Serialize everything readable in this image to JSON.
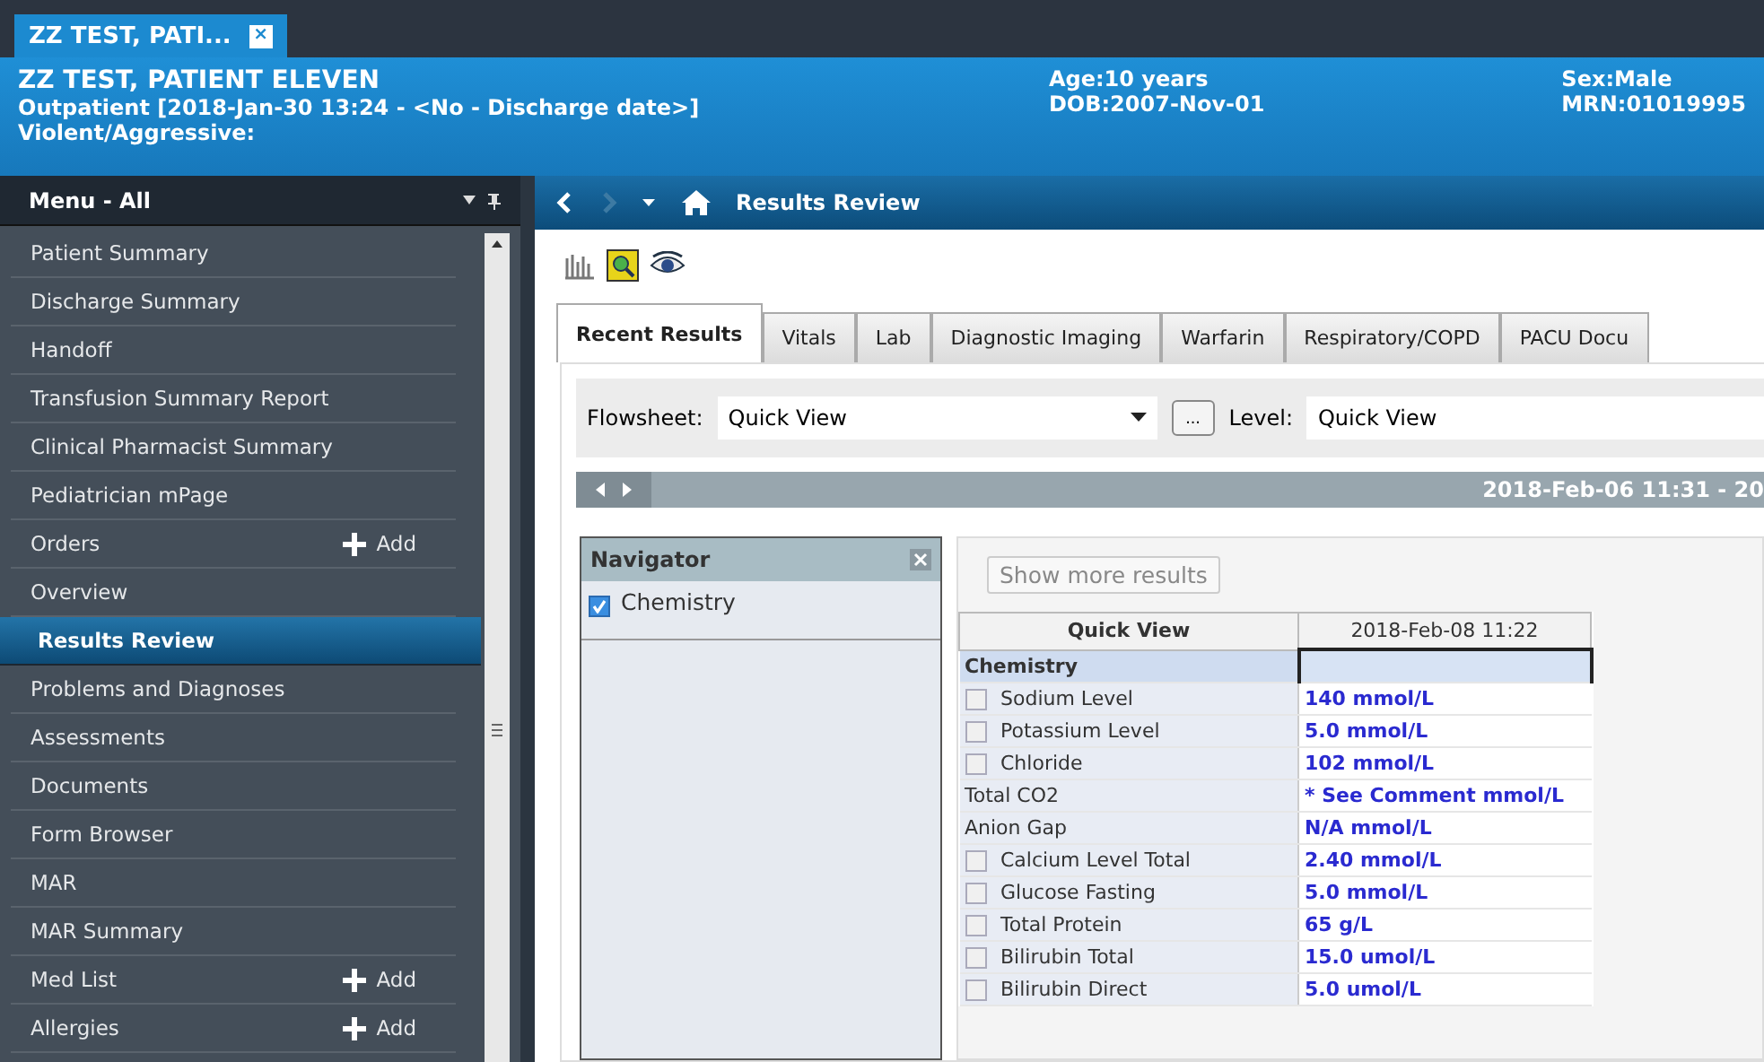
{
  "patient_tab": {
    "label": "ZZ TEST, PATI...",
    "close": "×"
  },
  "banner": {
    "name": "ZZ TEST, PATIENT ELEVEN",
    "encounter": "Outpatient [2018-Jan-30 13:24 -  <No - Discharge date>]",
    "alert": "Violent/Aggressive:",
    "age": "Age:10 years",
    "dob": "DOB:2007-Nov-01",
    "sex": "Sex:Male",
    "mrn": "MRN:01019995"
  },
  "menu": {
    "title": "Menu - All",
    "items": [
      {
        "label": "Patient Summary",
        "selected": false
      },
      {
        "label": "Discharge Summary",
        "selected": false
      },
      {
        "label": "Handoff",
        "selected": false
      },
      {
        "label": "Transfusion Summary Report",
        "selected": false
      },
      {
        "label": "Clinical Pharmacist Summary",
        "selected": false
      },
      {
        "label": "Pediatrician mPage",
        "selected": false
      },
      {
        "label": "Orders",
        "selected": false,
        "add": "Add"
      },
      {
        "label": "Overview",
        "selected": false
      },
      {
        "label": "Results Review",
        "selected": true
      },
      {
        "label": "Problems and Diagnoses",
        "selected": false
      },
      {
        "label": "Assessments",
        "selected": false
      },
      {
        "label": "Documents",
        "selected": false
      },
      {
        "label": "Form Browser",
        "selected": false
      },
      {
        "label": "MAR",
        "selected": false
      },
      {
        "label": "MAR Summary",
        "selected": false
      },
      {
        "label": "Med List",
        "selected": false,
        "add": "Add"
      },
      {
        "label": "Allergies",
        "selected": false,
        "add": "Add"
      }
    ]
  },
  "nav": {
    "title": "Results Review"
  },
  "tabs": [
    {
      "label": "Recent Results",
      "selected": true
    },
    {
      "label": "Vitals",
      "selected": false
    },
    {
      "label": "Lab",
      "selected": false
    },
    {
      "label": "Diagnostic Imaging",
      "selected": false
    },
    {
      "label": "Warfarin",
      "selected": false
    },
    {
      "label": "Respiratory/COPD",
      "selected": false
    },
    {
      "label": "PACU Docu",
      "selected": false
    }
  ],
  "filters": {
    "flowsheet_label": "Flowsheet:",
    "flowsheet_value": "Quick View",
    "more_button": "...",
    "level_label": "Level:",
    "level_value": "Quick View"
  },
  "date_range": "2018-Feb-06 11:31 - 20",
  "navigator": {
    "title": "Navigator",
    "items": [
      {
        "label": "Chemistry",
        "checked": true
      }
    ]
  },
  "show_more": "Show more results",
  "table": {
    "columns": [
      "Quick View",
      "2018-Feb-08 11:22"
    ],
    "rows": [
      {
        "kind": "group",
        "name": "Chemistry"
      },
      {
        "kind": "item",
        "name": "Sodium Level",
        "value": "140 mmol/L",
        "checked": false
      },
      {
        "kind": "item",
        "name": "Potassium Level",
        "value": "5.0 mmol/L",
        "checked": false
      },
      {
        "kind": "item",
        "name": "Chloride",
        "value": "102 mmol/L",
        "checked": false
      },
      {
        "kind": "plain",
        "name": "Total CO2",
        "value": "* See Comment mmol/L"
      },
      {
        "kind": "plain",
        "name": "Anion Gap",
        "value": "N/A mmol/L"
      },
      {
        "kind": "item",
        "name": "Calcium Level Total",
        "value": "2.40 mmol/L",
        "checked": false
      },
      {
        "kind": "item",
        "name": "Glucose Fasting",
        "value": "5.0 mmol/L",
        "checked": false
      },
      {
        "kind": "item",
        "name": "Total Protein",
        "value": "65 g/L",
        "checked": false
      },
      {
        "kind": "item",
        "name": "Bilirubin Total",
        "value": "15.0 umol/L",
        "checked": false
      },
      {
        "kind": "item",
        "name": "Bilirubin Direct",
        "value": "5.0 umol/L",
        "checked": false
      }
    ]
  }
}
